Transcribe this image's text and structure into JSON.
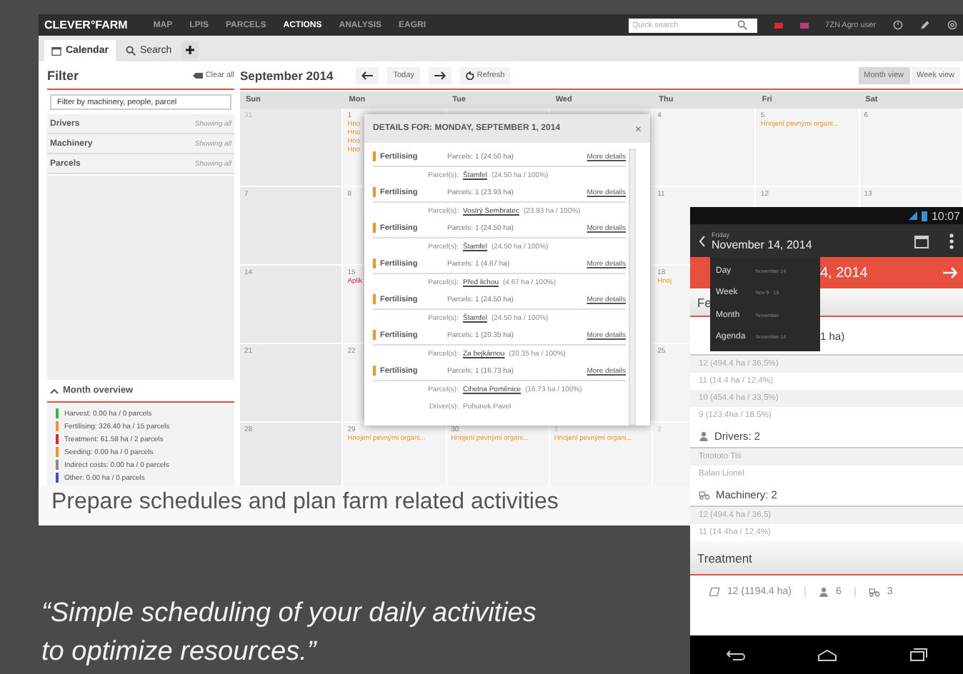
{
  "app": {
    "logo": "CLEVER°FARM",
    "menu": [
      {
        "label": "MAP",
        "selected": false
      },
      {
        "label": "LPIS",
        "selected": false
      },
      {
        "label": "PARCELS",
        "selected": false
      },
      {
        "label": "ACTIONS",
        "selected": true
      },
      {
        "label": "ANALYSIS",
        "selected": false
      },
      {
        "label": "EAGRI",
        "selected": false
      }
    ],
    "quick_search": {
      "placeholder": "Quick search"
    },
    "user": "7ZN Agro user",
    "tabs": [
      {
        "label": "Calendar",
        "selected": true
      },
      {
        "label": "Search",
        "selected": false
      }
    ],
    "filter": {
      "title": "Filter",
      "clear": "Clear all",
      "placeholder": "Filter by machinery, people, parcel",
      "groups": [
        {
          "label": "Drivers",
          "value": "Showing all"
        },
        {
          "label": "Machinery",
          "value": "Showing all"
        },
        {
          "label": "Parcels",
          "value": "Showing all"
        }
      ]
    },
    "overview": {
      "title": "Month overview",
      "items": [
        {
          "text": "Harvest: 0.00 ha / 0 parcels",
          "color": "#3cb44b"
        },
        {
          "text": "Fertilising: 326.40 ha / 15 parcels",
          "color": "#f0932b"
        },
        {
          "text": "Treatment: 61.58 ha / 2 parcels",
          "color": "#d7263d"
        },
        {
          "text": "Seeding: 0.00 ha / 0 parcels",
          "color": "#f0932b"
        },
        {
          "text": "Indirect costs: 0.00 ha / 0 parcels",
          "color": "#8a8a8a"
        },
        {
          "text": "Other: 0.00 ha / 0 parcels",
          "color": "#3a55b4"
        }
      ]
    },
    "calendar": {
      "month": "September 2014",
      "today": "Today",
      "refresh": "Refresh",
      "views": [
        {
          "label": "Month view",
          "selected": true
        },
        {
          "label": "Week view",
          "selected": false
        }
      ],
      "weekdays": [
        "Sun",
        "Mon",
        "Tue",
        "Wed",
        "Thu",
        "Fri",
        "Sat"
      ],
      "weeks": [
        {
          "sun": {
            "day": "31",
            "outside": true
          },
          "mon": {
            "day": "1",
            "events": [
              {
                "text": "Hno",
                "kind": "fertilising"
              },
              {
                "text": "Hno",
                "kind": "fertilising"
              },
              {
                "text": "Hno",
                "kind": "fertilising"
              },
              {
                "text": "Hno",
                "kind": "fertilising"
              }
            ]
          },
          "thu": {
            "day": "4"
          },
          "fri": {
            "day": "5",
            "events": [
              {
                "text": "Hnojení pevnými organi...",
                "kind": "fertilising"
              }
            ]
          },
          "sat": {
            "day": "6"
          }
        },
        {
          "sun": {
            "day": "7"
          },
          "mon": {
            "day": "8"
          },
          "thu": {
            "day": "11"
          },
          "fri": {
            "day": "12"
          },
          "sat": {
            "day": "13"
          }
        },
        {
          "sun": {
            "day": "14"
          },
          "mon": {
            "day": "15",
            "events": [
              {
                "text": "Aplik",
                "kind": "treatment"
              }
            ]
          },
          "thu": {
            "day": "18",
            "events": [
              {
                "text": "Hnoj",
                "kind": "fertilising"
              }
            ]
          }
        },
        {
          "sun": {
            "day": "21"
          },
          "mon": {
            "day": "22"
          },
          "thu": {
            "day": "25"
          }
        },
        {
          "sun": {
            "day": "28"
          },
          "mon": {
            "day": "29",
            "events": [
              {
                "text": "Hnojení pevnými organi...",
                "kind": "fertilising"
              }
            ]
          },
          "tue": {
            "day": "30",
            "events": [
              {
                "text": "Hnojení pevnými organi...",
                "kind": "fertilising"
              }
            ]
          },
          "wed": {
            "day": "1",
            "outside": true,
            "events": [
              {
                "text": "Hnojení pevnými organi...",
                "kind": "fertilising"
              }
            ]
          },
          "thu": {
            "day": "2",
            "outside": true
          }
        }
      ]
    },
    "details": {
      "title": "DETAILS FOR: MONDAY, SEPTEMBER 1, 2014",
      "close": "×",
      "rows": [
        {
          "type": "Fertilising",
          "summary": "Parcels: 1 (24.50 ha)",
          "link": "More details",
          "parcel_label": "Parcel(s):",
          "parcel": "Štamfel",
          "share": "(24.50 ha / 100%)"
        },
        {
          "type": "Fertilising",
          "summary": "Parcels: 1 (23.93 ha)",
          "link": "More details",
          "parcel_label": "Parcel(s):",
          "parcel": "Vostrý Sembratec",
          "share": "(23.93 ha / 100%)"
        },
        {
          "type": "Fertilising",
          "summary": "Parcels: 1 (24.50 ha)",
          "link": "More details",
          "parcel_label": "Parcel(s):",
          "parcel": "Štamfel",
          "share": "(24.50 ha / 100%)"
        },
        {
          "type": "Fertilising",
          "summary": "Parcels: 1 (4.67 ha)",
          "link": "More details",
          "parcel_label": "Parcel(s):",
          "parcel": "Před lichou",
          "share": "(4.67 ha / 100%)"
        },
        {
          "type": "Fertilising",
          "summary": "Parcels: 1 (24.50 ha)",
          "link": "More details",
          "parcel_label": "Parcel(s):",
          "parcel": "Štamfel",
          "share": "(24.50 ha / 100%)"
        },
        {
          "type": "Fertilising",
          "summary": "Parcels: 1 (20.35 ha)",
          "link": "More details",
          "parcel_label": "Parcel(s):",
          "parcel": "Za bejkárnou",
          "share": "(20.35 ha / 100%)"
        },
        {
          "type": "Fertilising",
          "summary": "Parcels: 1 (16.73 ha)",
          "link": "More details",
          "parcel_label": "Parcel(s):",
          "parcel": "Cihelna Pomĕnice",
          "share": "(16.73 ha / 100%)",
          "driver_label": "Driver(s):",
          "driver": "Pohunek Pavel"
        }
      ]
    }
  },
  "caption": "Prepare schedules and plan farm related activities",
  "quote": [
    "“Simple scheduling of your daily activities",
    "to optimize resources.”"
  ],
  "phone": {
    "time": "10:07",
    "weekday": "Friday",
    "date": "November 14, 2014",
    "date_bar": "4, 2014",
    "views": [
      {
        "label": "Day",
        "range": "November 14"
      },
      {
        "label": "Week",
        "range": "Nov 9 - 15"
      },
      {
        "label": "Month",
        "range": "November"
      },
      {
        "label": "Agenda",
        "range": "November 14"
      }
    ],
    "section": "Fe",
    "area": "1 ha)",
    "parcels": [
      "12 (494.4 ha / 36,5%)",
      "11 (14.4 ha / 12,4%)",
      "10 (454.4 ha / 33,5%)",
      "9 (123.4ha / 18.5%)"
    ],
    "drivers_title": "Drivers: 2",
    "drivers": [
      "Totototo Titi",
      "Balan Lionel"
    ],
    "machinery_title": "Machinery: 2",
    "machinery": [
      "12 (494.4 ha / 36,5)",
      "11 (14.4ha / 12,4%)"
    ],
    "treatment": "Treatment",
    "totals": {
      "area": "12 (1194.4 ha)",
      "drivers": "6",
      "machinery": "3"
    }
  }
}
